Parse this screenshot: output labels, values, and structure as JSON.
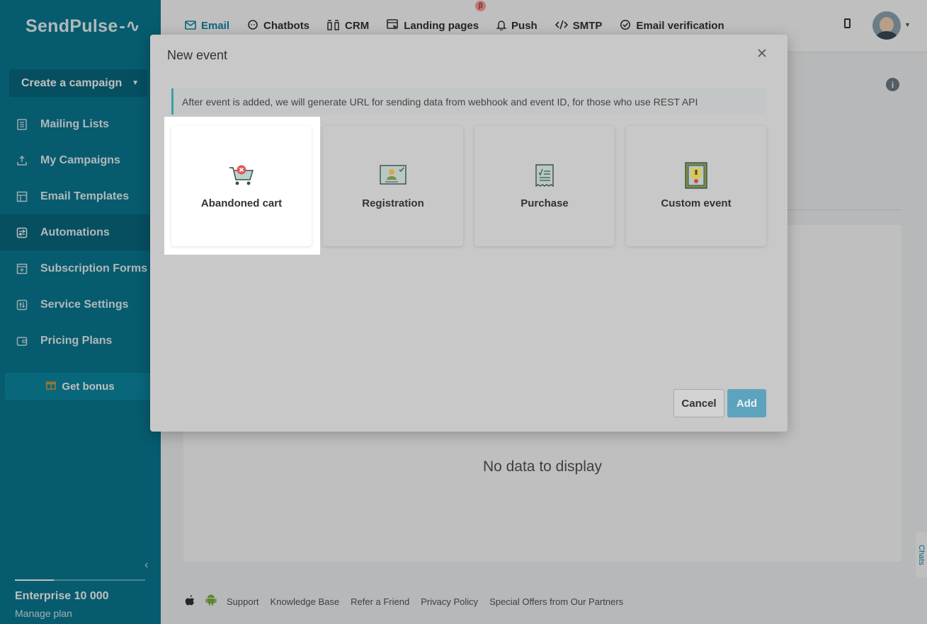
{
  "app": {
    "logo": "SendPulse",
    "logo_mark": "-∿"
  },
  "sidebar": {
    "create_campaign": "Create a campaign",
    "items": [
      {
        "label": "Mailing Lists",
        "icon": "list-icon"
      },
      {
        "label": "My Campaigns",
        "icon": "send-tray-icon"
      },
      {
        "label": "Email Templates",
        "icon": "template-icon"
      },
      {
        "label": "Automations",
        "icon": "automation-icon",
        "active": true
      },
      {
        "label": "Subscription Forms",
        "icon": "form-icon"
      },
      {
        "label": "Service Settings",
        "icon": "settings-icon"
      },
      {
        "label": "Pricing Plans",
        "icon": "wallet-icon"
      }
    ],
    "bonus": "Get bonus",
    "plan": "Enterprise 10 000",
    "manage_plan": "Manage plan"
  },
  "topnav": {
    "items": [
      {
        "label": "Email",
        "icon": "envelope-icon",
        "active": true
      },
      {
        "label": "Chatbots",
        "icon": "chat-icon"
      },
      {
        "label": "CRM",
        "icon": "crm-icon"
      },
      {
        "label": "Landing pages",
        "icon": "landing-icon",
        "badge": "β"
      },
      {
        "label": "Push",
        "icon": "bell-icon"
      },
      {
        "label": "SMTP",
        "icon": "code-icon"
      },
      {
        "label": "Email verification",
        "icon": "check-circle-icon"
      }
    ]
  },
  "main": {
    "no_data": "No data to display",
    "chats_tab": "Chats"
  },
  "footer": {
    "links": [
      "Support",
      "Knowledge Base",
      "Refer a Friend",
      "Privacy Policy",
      "Special Offers from Our Partners"
    ]
  },
  "modal": {
    "title": "New event",
    "notice": "After event is added, we will generate URL for sending data from webhook and event ID, for those who use REST API",
    "cards": [
      {
        "label": "Abandoned cart",
        "icon": "abandoned-cart-icon",
        "highlighted": true
      },
      {
        "label": "Registration",
        "icon": "registration-icon"
      },
      {
        "label": "Purchase",
        "icon": "receipt-icon"
      },
      {
        "label": "Custom event",
        "icon": "custom-event-icon"
      }
    ],
    "cancel": "Cancel",
    "add": "Add"
  },
  "colors": {
    "sidebar": "#0a7a93",
    "accent": "#0b8aa7",
    "add_button": "#5ea3bd"
  }
}
